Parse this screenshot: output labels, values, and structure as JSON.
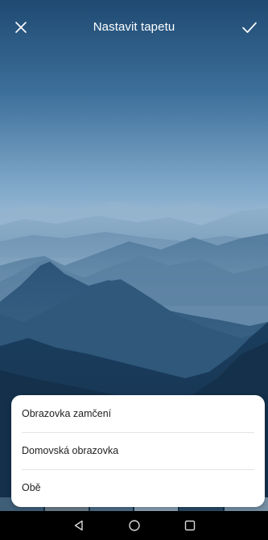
{
  "header": {
    "title": "Nastavit tapetu",
    "close_icon": "close-icon",
    "confirm_icon": "checkmark-icon"
  },
  "sheet": {
    "options": [
      {
        "label": "Obrazovka zamčení"
      },
      {
        "label": "Domovská obrazovka"
      },
      {
        "label": "Obě"
      }
    ]
  },
  "navbar": {
    "back_icon": "back-triangle-icon",
    "home_icon": "home-circle-icon",
    "recents_icon": "recents-square-icon"
  },
  "colors": {
    "sky_top": "#1f4e78",
    "sky_mid": "#8fb3d0",
    "mountain_dark": "#1b3d5a",
    "sheet_bg": "#ffffff",
    "navbar_bg": "#000000"
  }
}
